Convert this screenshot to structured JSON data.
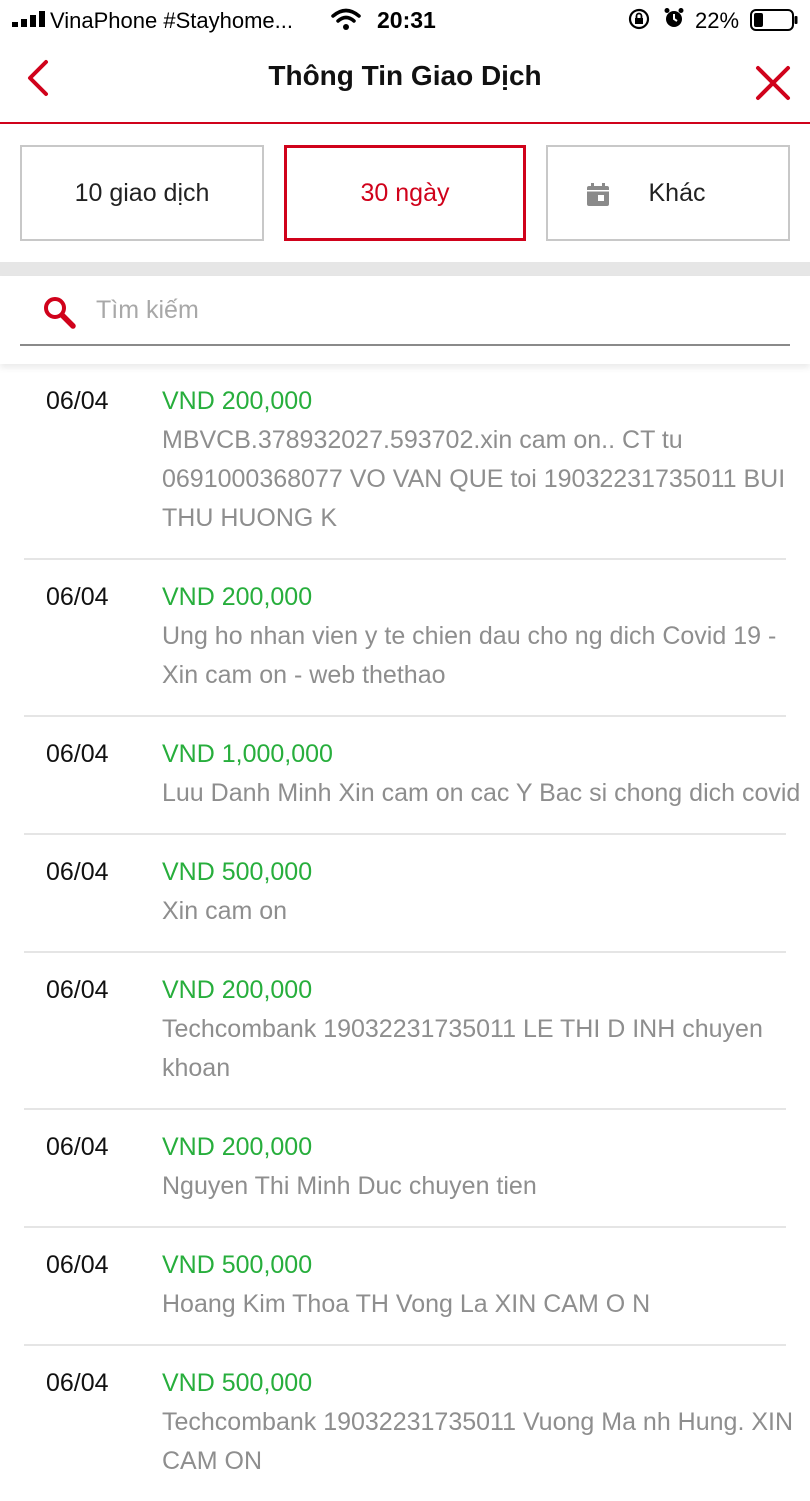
{
  "status_bar": {
    "carrier": "VinaPhone #Stayhome...",
    "time": "20:31",
    "battery": "22%",
    "icons": [
      "signal-icon",
      "wifi-icon",
      "rotation-lock-icon",
      "alarm-icon",
      "battery-icon"
    ]
  },
  "nav": {
    "title": "Thông Tin Giao Dịch",
    "back_icon": "chevron-left-icon",
    "close_icon": "close-icon",
    "accent": "#d0021b"
  },
  "filters": {
    "tab1": "10 giao dịch",
    "tab2": "30 ngày",
    "tab3": "Khác",
    "selected": "30 ngày",
    "tab3_icon": "calendar-icon"
  },
  "search": {
    "placeholder": "Tìm kiếm",
    "value": ""
  },
  "amount_color": "#27ae3c",
  "transactions": [
    {
      "date": "06/04",
      "amount": "VND 200,000",
      "description": "MBVCB.378932027.593702.xin cam on.. CT tu 0691000368077 VO VAN QUE toi 19032231735011 BUI THU HUONG K"
    },
    {
      "date": "06/04",
      "amount": "VND 200,000",
      "description": "Ung ho nhan vien y te chien dau cho ng dich Covid 19 - Xin cam on - web thethao"
    },
    {
      "date": "06/04",
      "amount": "VND 1,000,000",
      "description": "Luu Danh Minh Xin cam on cac Y Bac si chong dich covid"
    },
    {
      "date": "06/04",
      "amount": "VND 500,000",
      "description": "Xin cam on"
    },
    {
      "date": "06/04",
      "amount": "VND 200,000",
      "description": "Techcombank 19032231735011 LE THI D INH chuyen khoan"
    },
    {
      "date": "06/04",
      "amount": "VND 200,000",
      "description": "Nguyen Thi Minh Duc chuyen tien"
    },
    {
      "date": "06/04",
      "amount": "VND 500,000",
      "description": "Hoang Kim Thoa TH Vong La XIN CAM O N"
    },
    {
      "date": "06/04",
      "amount": "VND 500,000",
      "description": "Techcombank 19032231735011 Vuong Ma nh Hung. XIN CAM ON"
    }
  ]
}
